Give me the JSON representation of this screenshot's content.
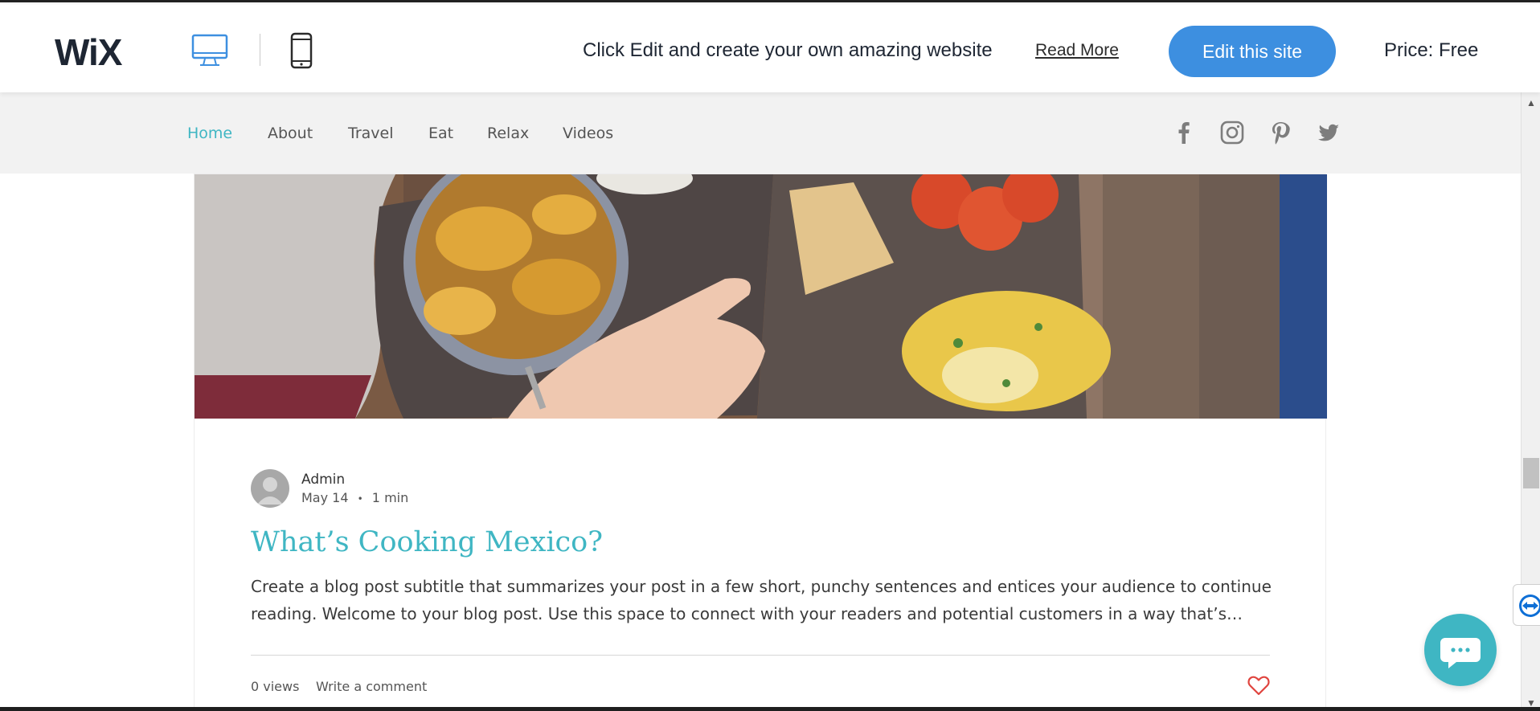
{
  "wix_bar": {
    "logo": "WiX",
    "promo_text": "Click Edit and create your own amazing website",
    "read_more": "Read More",
    "edit_button": "Edit this site",
    "price": "Price: Free",
    "desktop_icon": "desktop-icon",
    "mobile_icon": "mobile-icon"
  },
  "site_nav": {
    "items": [
      {
        "label": "Home",
        "active": true
      },
      {
        "label": "About",
        "active": false
      },
      {
        "label": "Travel",
        "active": false
      },
      {
        "label": "Eat",
        "active": false
      },
      {
        "label": "Relax",
        "active": false
      },
      {
        "label": "Videos",
        "active": false
      }
    ],
    "social": [
      "facebook-icon",
      "instagram-icon",
      "pinterest-icon",
      "twitter-icon"
    ]
  },
  "post": {
    "author": "Admin",
    "date": "May 14",
    "separator": "•",
    "read_time": "1 min",
    "title": "What’s Cooking Mexico?",
    "excerpt": "Create a blog post subtitle that summarizes your post in a few short, punchy sentences and entices your audience to continue reading. Welcome to your blog post. Use this space to connect with your readers and potential customers in a way that’s…",
    "views": "0 views",
    "write_comment": "Write a comment"
  },
  "colors": {
    "accent": "#3fb6c3",
    "edit_button": "#3d8fe0",
    "nav_bg": "#f2f2f2",
    "heart": "#e0443e"
  }
}
